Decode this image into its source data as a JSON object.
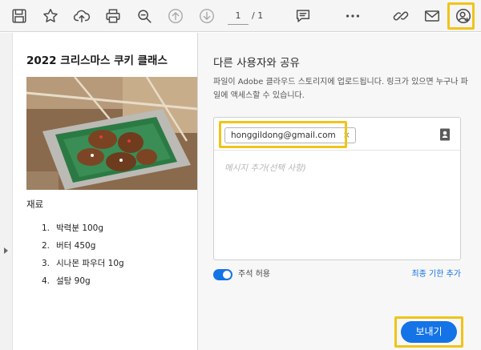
{
  "toolbar": {
    "icons": [
      "save-icon",
      "bookmark-star-icon",
      "upload-cloud-icon",
      "print-icon",
      "zoom-search-icon",
      "page-up-icon",
      "page-down-icon",
      "comment-icon",
      "more-icon",
      "share-link-icon",
      "email-icon",
      "add-people-icon"
    ],
    "current_page": "1",
    "total_pages": "/ 1"
  },
  "document": {
    "title": "2022 크리스마스 쿠키 클래스",
    "section_heading": "재료",
    "ingredients": [
      {
        "num": "1.",
        "text": "박력분 100g"
      },
      {
        "num": "2.",
        "text": "버터 450g"
      },
      {
        "num": "3.",
        "text": "시나몬 파우더 10g"
      },
      {
        "num": "4.",
        "text": "설탕 90g"
      }
    ]
  },
  "share_panel": {
    "title": "다른 사용자와 공유",
    "description": "파일이 Adobe 클라우드 스토리지에 업로드됩니다. 링크가 있으면 누구나 파일에 액세스할 수 있습니다.",
    "recipient_email": "honggildong@gmail.com",
    "remove_symbol": "×",
    "message_placeholder": "메시지 추가(선택 사항)",
    "allow_comments_label": "주석 허용",
    "allow_comments_on": true,
    "deadline_link": "최종 기한 추가",
    "send_button": "보내기"
  },
  "colors": {
    "accent": "#1473e6",
    "highlight": "#f0c419",
    "toolbar_bg": "#f5f5f5",
    "panel_bg": "#f7f7f7"
  }
}
